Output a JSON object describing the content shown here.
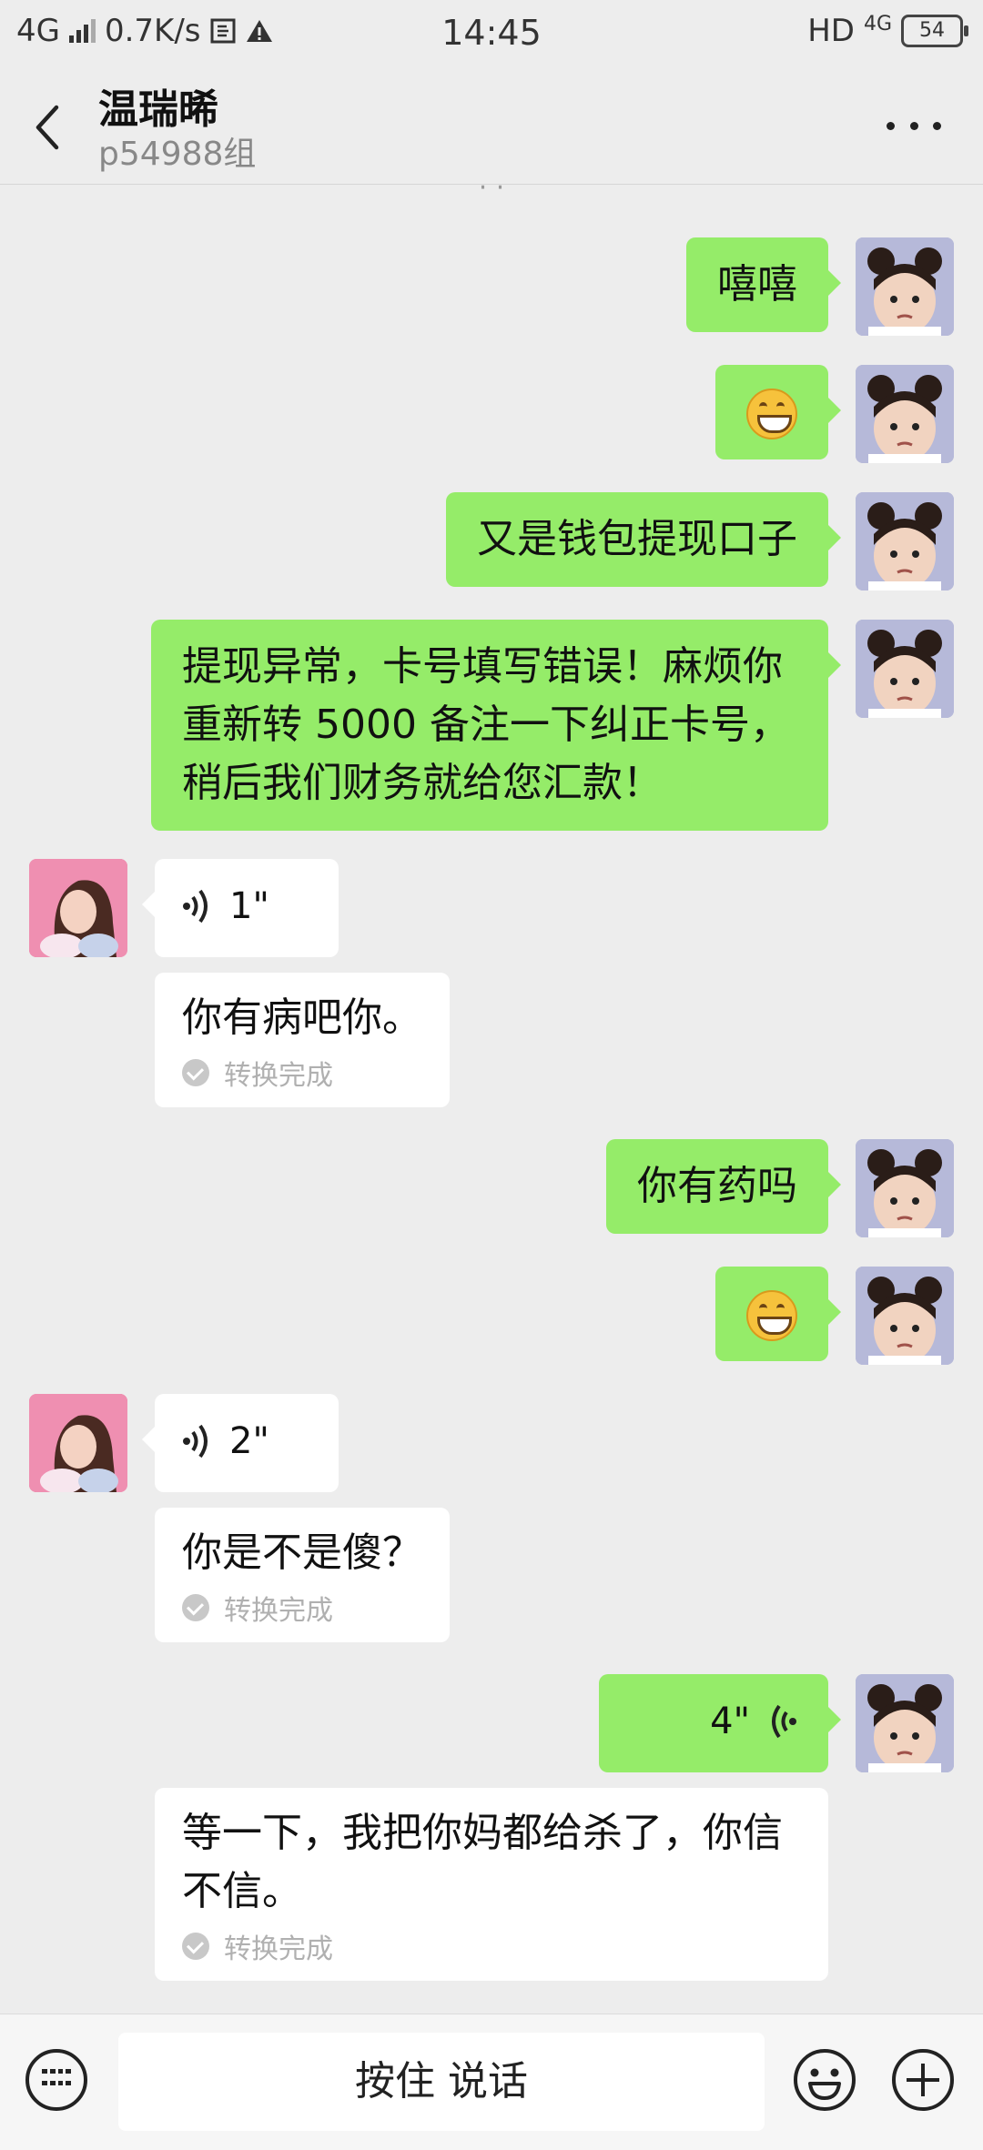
{
  "status_bar": {
    "network": "4G",
    "speed": "0.7K/s",
    "time": "14:45",
    "hd": "HD",
    "net_right": "4G",
    "battery": "54"
  },
  "header": {
    "title": "温瑞晞",
    "subtitle": "p54988组"
  },
  "messages": [
    {
      "side": "out",
      "text": "嘻嘻"
    },
    {
      "side": "out",
      "emoji": "grin-emoji"
    },
    {
      "side": "out",
      "text": "又是钱包提现口子"
    },
    {
      "side": "out",
      "lines": [
        "提现异常，卡号填写错误！麻烦你",
        "重新转 5000 备注一下纠正卡号，",
        "稍后我们财务就给您汇款！"
      ]
    },
    {
      "side": "in",
      "voice_duration": "1\"",
      "transcript": "你有病吧你。",
      "transcript_status": "转换完成"
    },
    {
      "side": "out",
      "text": "你有药吗"
    },
    {
      "side": "out",
      "emoji": "grin-emoji"
    },
    {
      "side": "in",
      "voice_duration": "2\"",
      "transcript": "你是不是傻？",
      "transcript_status": "转换完成"
    },
    {
      "side": "out",
      "voice_duration": "4\"",
      "transcript_lines": [
        "等一下，我把你妈都给杀了，你信",
        "不信。"
      ],
      "transcript_status": "转换完成"
    }
  ],
  "bottom_bar": {
    "hold_to_talk": "按住 说话"
  },
  "colors": {
    "outgoing_bubble": "#95ec69",
    "incoming_bubble": "#ffffff",
    "background": "#ededed"
  }
}
